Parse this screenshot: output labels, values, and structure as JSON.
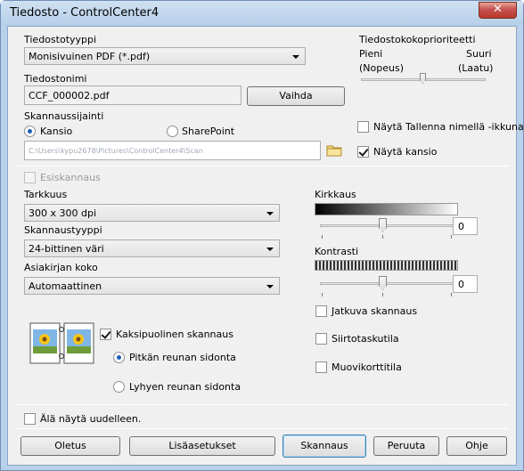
{
  "window": {
    "title": "Tiedosto - ControlCenter4",
    "close_label": "✕"
  },
  "file_type": {
    "label": "Tiedostotyyppi",
    "value": "Monisivuinen PDF (*.pdf)"
  },
  "file_size_priority": {
    "label": "Tiedostokokoprioriteetti",
    "small": "Pieni",
    "large": "Suuri",
    "fast": "(Nopeus)",
    "quality": "(Laatu)"
  },
  "file_name": {
    "label": "Tiedostonimi",
    "value": "CCF_000002.pdf",
    "change_button": "Vaihda"
  },
  "scan_location": {
    "label": "Skannaussijainti",
    "folder_option": "Kansio",
    "sharepoint_option": "SharePoint",
    "path": "C:\\Users\\kypu2678\\Pictures\\ControlCenter4\\Scan"
  },
  "show_save_as": {
    "label": "Näytä Tallenna nimellä -ikkuna",
    "checked": false
  },
  "show_folder": {
    "label": "Näytä kansio",
    "checked": true
  },
  "prescan": {
    "label": "Esiskannaus",
    "checked": false
  },
  "resolution": {
    "label": "Tarkkuus",
    "value": "300 x 300 dpi"
  },
  "scan_type": {
    "label": "Skannaustyyppi",
    "value": "24-bittinen väri"
  },
  "document_size": {
    "label": "Asiakirjan koko",
    "value": "Automaattinen"
  },
  "brightness": {
    "label": "Kirkkaus",
    "value": "0"
  },
  "contrast": {
    "label": "Kontrasti",
    "value": "0"
  },
  "duplex": {
    "label": "Kaksipuolinen skannaus",
    "checked": true,
    "long_edge": "Pitkän reunan sidonta",
    "short_edge": "Lyhyen reunan sidonta"
  },
  "continuous_scan": {
    "label": "Jatkuva skannaus",
    "checked": false
  },
  "carrier_sheet": {
    "label": "Siirtotaskutila",
    "checked": false
  },
  "plastic_card": {
    "label": "Muovikorttitila",
    "checked": false
  },
  "dont_show_again": {
    "label": "Älä näytä uudelleen.",
    "checked": false
  },
  "buttons": {
    "default": "Oletus",
    "advanced": "Lisäasetukset",
    "scan": "Skannaus",
    "cancel": "Peruuta",
    "help": "Ohje"
  },
  "icons": {
    "folder": "folder-icon",
    "duplex": "duplex-page-icon"
  }
}
